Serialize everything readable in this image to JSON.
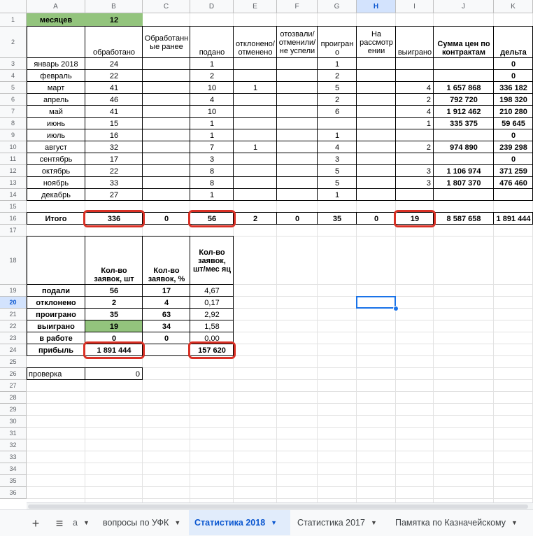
{
  "columns": [
    "A",
    "B",
    "C",
    "D",
    "E",
    "F",
    "G",
    "H",
    "I",
    "J",
    "K"
  ],
  "selected_column": "H",
  "rows": [
    "1",
    "2",
    "3",
    "4",
    "5",
    "6",
    "7",
    "8",
    "9",
    "10",
    "11",
    "12",
    "13",
    "14",
    "15",
    "16",
    "17",
    "18",
    "19",
    "20",
    "21",
    "22",
    "23",
    "24",
    "25",
    "26",
    "27",
    "28",
    "29",
    "30",
    "31",
    "32",
    "33",
    "34",
    "35",
    "36"
  ],
  "selected_row": "20",
  "header": {
    "a1": "месяцев",
    "b1": "12",
    "b2": "обработано",
    "c2": "Обработанн ые ранее",
    "d2": "подано",
    "e2": "отклонено/ отменено",
    "f2": "отозвали/ отменили/ не успели",
    "g2": "проигран о",
    "h2": "На рассмотр ении",
    "i2": "выиграно",
    "j2": "Сумма цен по контрактам",
    "k2": "дельта"
  },
  "months": [
    {
      "name": "январь 2018",
      "b": "24",
      "d": "1",
      "e": "",
      "g": "1",
      "i": "",
      "j": "",
      "k": "0"
    },
    {
      "name": "февраль",
      "b": "22",
      "d": "2",
      "e": "",
      "g": "2",
      "i": "",
      "j": "",
      "k": "0"
    },
    {
      "name": "март",
      "b": "41",
      "d": "10",
      "e": "1",
      "g": "5",
      "i": "4",
      "j": "1 657 868",
      "k": "336 182"
    },
    {
      "name": "апрель",
      "b": "46",
      "d": "4",
      "e": "",
      "g": "2",
      "i": "2",
      "j": "792 720",
      "k": "198 320"
    },
    {
      "name": "май",
      "b": "41",
      "d": "10",
      "e": "",
      "g": "6",
      "i": "4",
      "j": "1 912 462",
      "k": "210 280"
    },
    {
      "name": "июнь",
      "b": "15",
      "d": "1",
      "e": "",
      "g": "",
      "i": "1",
      "j": "335 375",
      "k": "59 645"
    },
    {
      "name": "июль",
      "b": "16",
      "d": "1",
      "e": "",
      "g": "1",
      "i": "",
      "j": "",
      "k": "0"
    },
    {
      "name": "август",
      "b": "32",
      "d": "7",
      "e": "1",
      "g": "4",
      "i": "2",
      "j": "974 890",
      "k": "239 298"
    },
    {
      "name": "сентябрь",
      "b": "17",
      "d": "3",
      "e": "",
      "g": "3",
      "i": "",
      "j": "",
      "k": "0"
    },
    {
      "name": "октябрь",
      "b": "22",
      "d": "8",
      "e": "",
      "g": "5",
      "i": "3",
      "j": "1 106 974",
      "k": "371 259"
    },
    {
      "name": "ноябрь",
      "b": "33",
      "d": "8",
      "e": "",
      "g": "5",
      "i": "3",
      "j": "1 807 370",
      "k": "476 460"
    },
    {
      "name": "декабрь",
      "b": "27",
      "d": "1",
      "e": "",
      "g": "1",
      "i": "",
      "j": "",
      "k": ""
    }
  ],
  "totals": {
    "label": "Итого",
    "b": "336",
    "c": "0",
    "d": "56",
    "e": "2",
    "f": "0",
    "g": "35",
    "h": "0",
    "i": "19",
    "j": "8 587 658",
    "k": "1 891 444"
  },
  "summary": {
    "hdr_b": "Кол-во заявок, шт",
    "hdr_c": "Кол-во заявок, %",
    "hdr_d": "Кол-во заявок, шт/мес яц",
    "rows": [
      {
        "label": "подали",
        "b": "56",
        "c": "17",
        "d": "4,67"
      },
      {
        "label": "отклонено",
        "b": "2",
        "c": "4",
        "d": "0,17"
      },
      {
        "label": "проиграно",
        "b": "35",
        "c": "63",
        "d": "2,92"
      },
      {
        "label": "выиграно",
        "b": "19",
        "c": "34",
        "d": "1,58"
      },
      {
        "label": "в работе",
        "b": "0",
        "c": "0",
        "d": "0,00"
      }
    ],
    "profit_label": "прибыль",
    "profit_b": "1 891 444",
    "profit_d": "157 620",
    "check_label": "проверка",
    "check_value": "0"
  },
  "tabs": [
    {
      "label": "а",
      "active": false
    },
    {
      "label": "вопросы по УФК",
      "active": false
    },
    {
      "label": "Статистика  2018",
      "active": true
    },
    {
      "label": "Статистика 2017",
      "active": false
    },
    {
      "label": "Памятка по Казначейскому",
      "active": false
    }
  ],
  "colors": {
    "highlight": "#d93025",
    "green": "#93c47d",
    "accent": "#0b57d0"
  }
}
